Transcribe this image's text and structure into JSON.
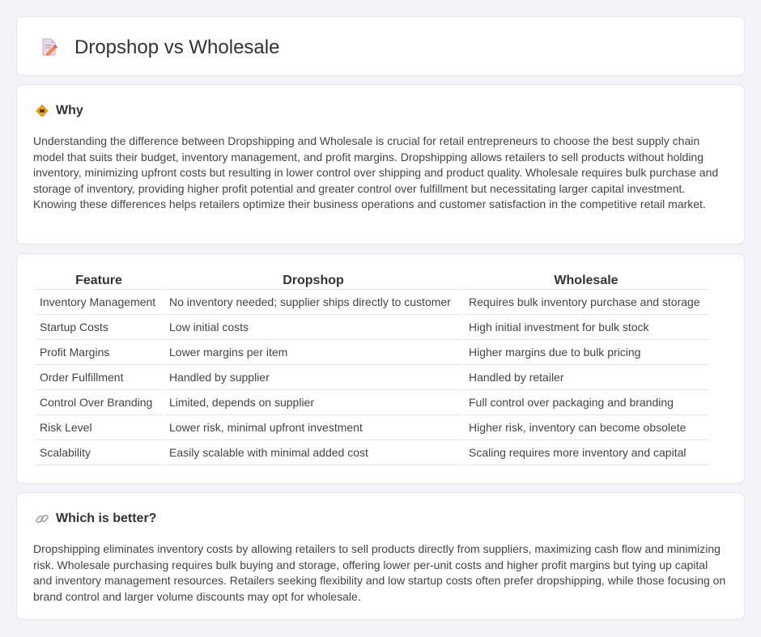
{
  "header": {
    "title": "Dropshop vs Wholesale",
    "icon": "document-pencil-icon"
  },
  "why": {
    "title": "Why",
    "icon": "warning-sign-icon",
    "text": "Understanding the difference between Dropshipping and Wholesale is crucial for retail entrepreneurs to choose the best supply chain model that suits their budget, inventory management, and profit margins. Dropshipping allows retailers to sell products without holding inventory, minimizing upfront costs but resulting in lower control over shipping and product quality. Wholesale requires bulk purchase and storage of inventory, providing higher profit potential and greater control over fulfillment but necessitating larger capital investment. Knowing these differences helps retailers optimize their business operations and customer satisfaction in the competitive retail market."
  },
  "table": {
    "headers": [
      "Feature",
      "Dropshop",
      "Wholesale"
    ],
    "rows": [
      [
        "Inventory Management",
        "No inventory needed; supplier ships directly to customer",
        "Requires bulk inventory purchase and storage"
      ],
      [
        "Startup Costs",
        "Low initial costs",
        "High initial investment for bulk stock"
      ],
      [
        "Profit Margins",
        "Lower margins per item",
        "Higher margins due to bulk pricing"
      ],
      [
        "Order Fulfillment",
        "Handled by supplier",
        "Handled by retailer"
      ],
      [
        "Control Over Branding",
        "Limited, depends on supplier",
        "Full control over packaging and branding"
      ],
      [
        "Risk Level",
        "Lower risk, minimal upfront investment",
        "Higher risk, inventory can become obsolete"
      ],
      [
        "Scalability",
        "Easily scalable with minimal added cost",
        "Scaling requires more inventory and capital"
      ]
    ]
  },
  "better": {
    "title": "Which is better?",
    "icon": "link-icon",
    "text": "Dropshipping eliminates inventory costs by allowing retailers to sell products directly from suppliers, maximizing cash flow and minimizing risk. Wholesale purchasing requires bulk buying and storage, offering lower per-unit costs and higher profit margins but tying up capital and inventory management resources. Retailers seeking flexibility and low startup costs often prefer dropshipping, while those focusing on brand control and larger volume discounts may opt for wholesale."
  }
}
